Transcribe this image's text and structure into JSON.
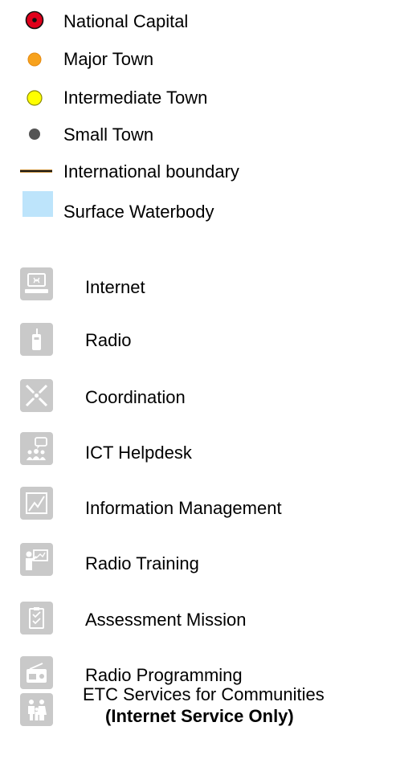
{
  "map_legend": {
    "symbols": [
      {
        "label": "National Capital",
        "icon": "national-capital-icon",
        "color": "#e0001b"
      },
      {
        "label": "Major Town",
        "icon": "major-town-icon",
        "color": "#f7a21d"
      },
      {
        "label": "Intermediate Town",
        "icon": "intermediate-town-icon",
        "color": "#ffff00"
      },
      {
        "label": "Small Town",
        "icon": "small-town-icon",
        "color": "#555555"
      },
      {
        "label": "International boundary",
        "icon": "international-boundary-icon",
        "color": "#1a1a1a",
        "accent": "#c98f3a"
      },
      {
        "label": "Surface Waterbody",
        "icon": "waterbody-icon",
        "color": "#bde4fb"
      }
    ],
    "services": [
      {
        "label": "Internet",
        "icon": "internet-icon"
      },
      {
        "label": "Radio",
        "icon": "radio-icon"
      },
      {
        "label": "Coordination",
        "icon": "coordination-icon"
      },
      {
        "label": "ICT Helpdesk",
        "icon": "ict-helpdesk-icon"
      },
      {
        "label": "Information Management",
        "icon": "information-management-icon"
      },
      {
        "label": "Radio Training",
        "icon": "radio-training-icon"
      },
      {
        "label": "Assessment Mission",
        "icon": "assessment-mission-icon"
      },
      {
        "label": "Radio Programming",
        "icon": "radio-programming-icon"
      },
      {
        "label": "ETC Services for Communities",
        "sublabel": "(Internet Service Only)",
        "icon": "communities-icon"
      }
    ],
    "icon_background": "#c9c9c9"
  }
}
